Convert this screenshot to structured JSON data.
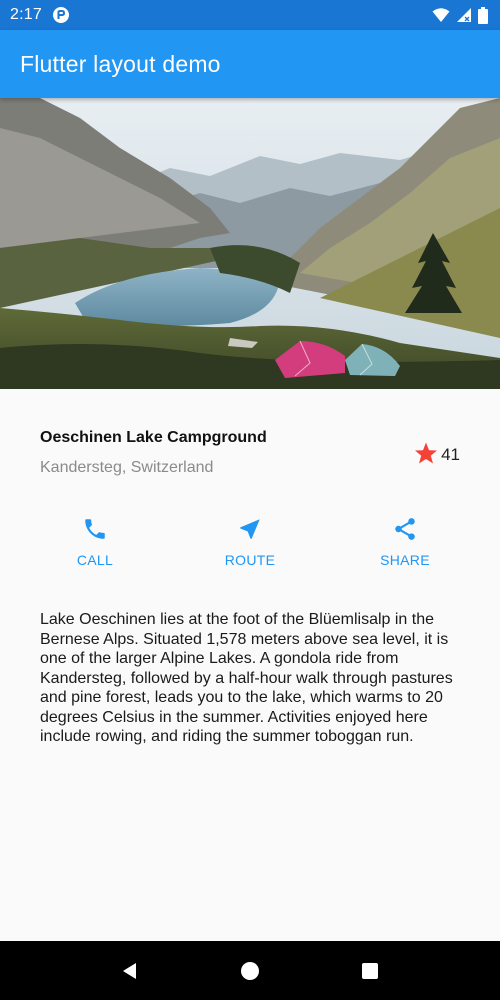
{
  "status_bar": {
    "time": "2:17",
    "icons": [
      "notification-icon",
      "wifi-icon",
      "signal-icon",
      "battery-icon"
    ]
  },
  "app_bar": {
    "title": "Flutter layout demo",
    "color": "#2196f3"
  },
  "hero_image": {
    "description_icon": "lake-landscape-image"
  },
  "place": {
    "name": "Oeschinen Lake Campground",
    "location": "Kandersteg, Switzerland",
    "rating_count": "41",
    "star_color": "#f44336"
  },
  "actions": [
    {
      "label": "CALL",
      "icon": "phone-icon"
    },
    {
      "label": "ROUTE",
      "icon": "navigation-icon"
    },
    {
      "label": "SHARE",
      "icon": "share-icon"
    }
  ],
  "description": "Lake Oeschinen lies at the foot of the Blüemlisalp in the Bernese Alps. Situated 1,578 meters above sea level, it is one of the larger Alpine Lakes. A gondola ride from Kandersteg, followed by a half-hour walk through pastures and pine forest, leads you to the lake, which warms to 20 degrees Celsius in the summer. Activities enjoyed here include rowing, and riding the summer toboggan run.",
  "nav_bar": {
    "icons": [
      "back-icon",
      "home-icon",
      "recents-icon"
    ]
  }
}
